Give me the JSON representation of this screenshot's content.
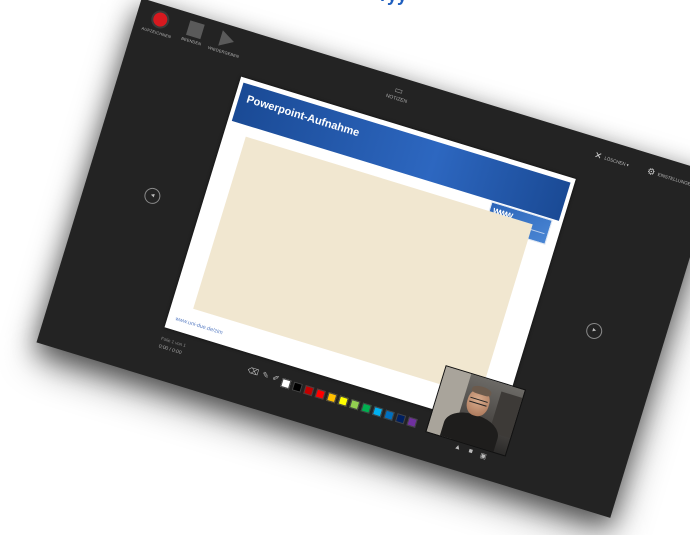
{
  "toolbar": {
    "record_label": "AUFZEICHNEN",
    "stop_label": "BEENDEN",
    "replay_label": "WIEDERGEBEN"
  },
  "notes": {
    "label": "NOTIZEN"
  },
  "top_right": {
    "clear_label": "LÖSCHEN ▾",
    "settings_label": "EINSTELLUNGEN ▾"
  },
  "slide": {
    "title": "Powerpoint-Aufnahme",
    "logo_text": "WWW",
    "url": "www.uni-due.de/zim"
  },
  "status": {
    "slide_number": "Folie 1 von 1",
    "timer": "0:00 / 0:00"
  },
  "palette": {
    "colors": [
      "#ffffff",
      "#000000",
      "#c00000",
      "#ff0000",
      "#ffc000",
      "#ffff00",
      "#92d050",
      "#00b050",
      "#00b0f0",
      "#0070c0",
      "#002060",
      "#7030a0"
    ]
  },
  "icons": {
    "prev": "◂",
    "next": "▸"
  }
}
